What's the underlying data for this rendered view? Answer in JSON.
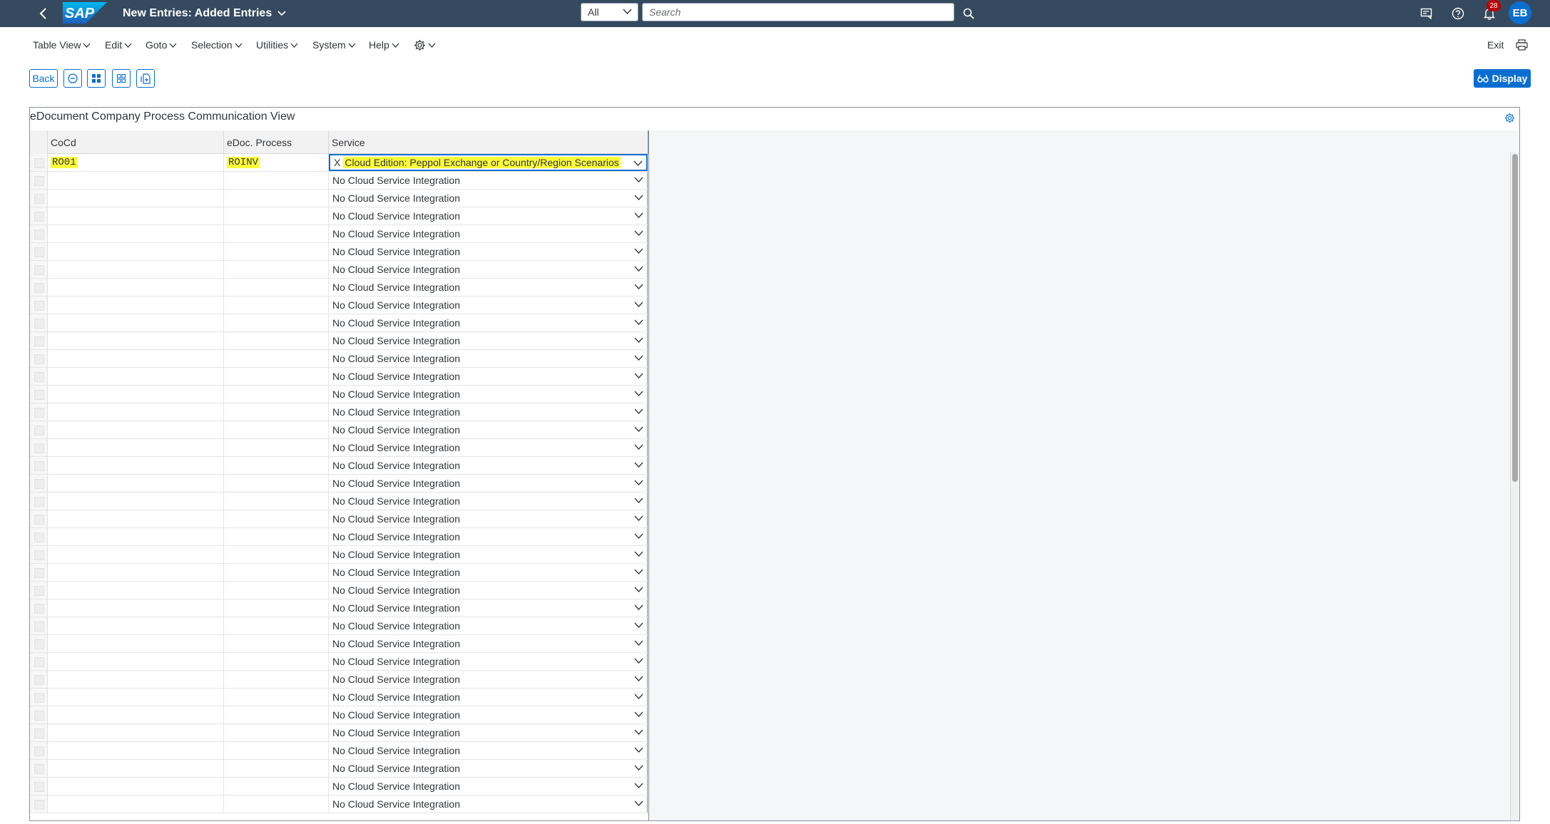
{
  "shell": {
    "title": "New Entries: Added Entries",
    "scope": "All",
    "search_placeholder": "Search",
    "notification_count": "28",
    "avatar_initials": "EB"
  },
  "menu": {
    "items": [
      "Table View",
      "Edit",
      "Goto",
      "Selection",
      "Utilities",
      "System",
      "Help"
    ],
    "exit": "Exit"
  },
  "toolbar": {
    "back": "Back",
    "display": "Display"
  },
  "table": {
    "title": "eDocument Company Process Communication View",
    "columns": [
      "CoCd",
      "eDoc. Process",
      "Service"
    ],
    "first_row": {
      "cocd": "RO01",
      "process": "ROINV",
      "service_key": "X",
      "service": "Cloud Edition: Peppol Exchange or Country/Region Scenarios"
    },
    "default_service": "No Cloud Service Integration",
    "empty_row_count": 36
  },
  "colors": {
    "shell": "#354a5f",
    "accent": "#0a6ed1",
    "highlight": "#fdfd3a",
    "badge": "#bb0000"
  }
}
